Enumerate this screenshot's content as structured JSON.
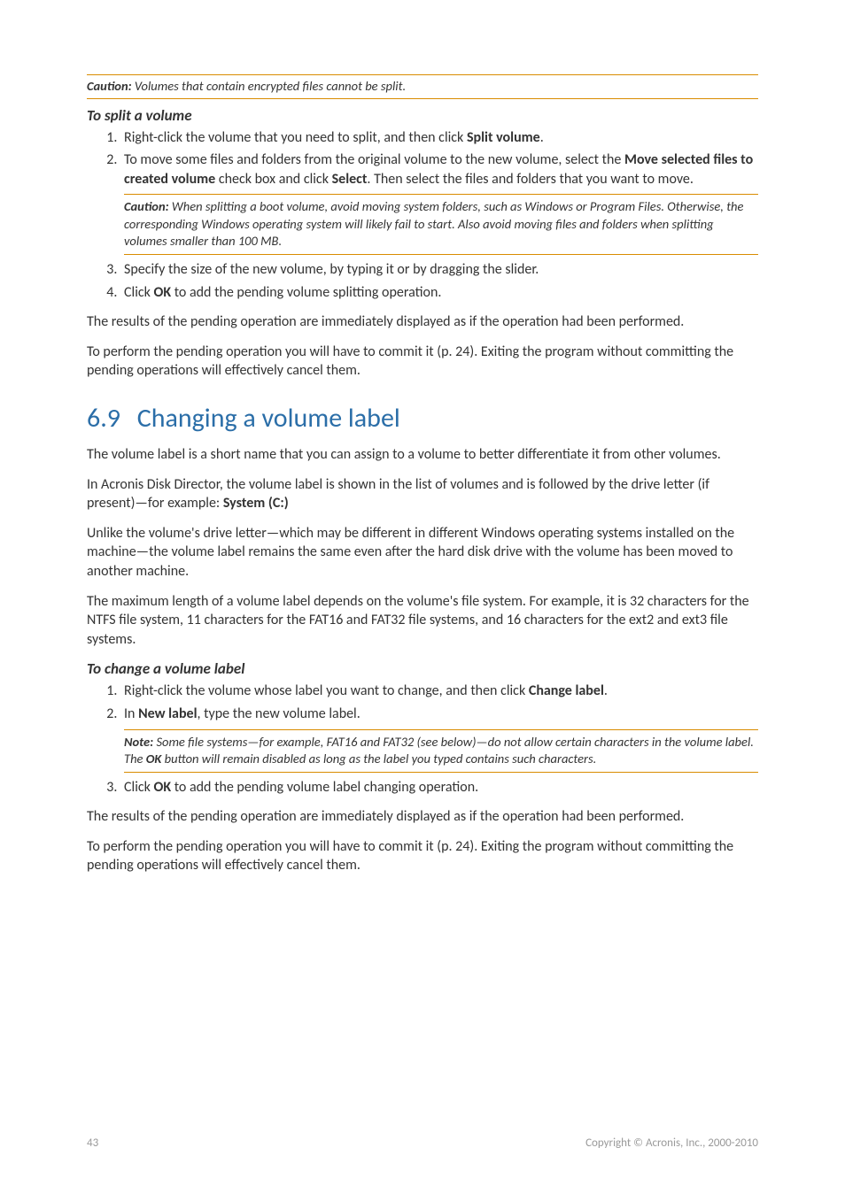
{
  "caution1": {
    "lead": "Caution:",
    "text": " Volumes that contain encrypted files cannot be split."
  },
  "splitHead": "To split a volume",
  "steps1": {
    "s1a": "Right-click the volume that you need to split, and then click ",
    "s1b": "Split volume",
    "s1c": ".",
    "s2a": "To move some files and folders from the original volume to the new volume, select the ",
    "s2b": "Move selected files to created volume",
    "s2c": " check box and click ",
    "s2d": "Select",
    "s2e": ". Then select the files and folders that you want to move.",
    "s3": "Specify the size of the new volume, by typing it or by dragging the slider.",
    "s4a": "Click ",
    "s4b": "OK",
    "s4c": " to add the pending volume splitting operation."
  },
  "caution2": {
    "lead": "Caution:",
    "text": " When splitting a boot volume, avoid moving system folders, such as Windows or Program Files. Otherwise, the corresponding Windows operating system will likely fail to start. Also avoid moving files and folders when splitting volumes smaller than 100 MB."
  },
  "para1": "The results of the pending operation are immediately displayed as if the operation had been performed.",
  "para2": "To perform the pending operation you will have to commit it (p. 24). Exiting the program without committing the pending operations will effectively cancel them.",
  "section": {
    "num": "6.9",
    "title": "Changing a volume label"
  },
  "sec_p1": "The volume label is a short name that you can assign to a volume to better differentiate it from other volumes.",
  "sec_p2a": "In Acronis Disk Director, the volume label is shown in the list of volumes and is followed by the drive letter (if present)—for example: ",
  "sec_p2b": "System (C:)",
  "sec_p3": "Unlike the volume's drive letter—which may be different in different Windows operating systems installed on the machine—the volume label remains the same even after the hard disk drive with the volume has been moved to another machine.",
  "sec_p4": "The maximum length of a volume label depends on the volume's file system. For example, it is 32 characters for the NTFS file system, 11 characters for the FAT16 and FAT32 file systems, and 16 characters for the ext2 and ext3 file systems.",
  "changeHead": "To change a volume label",
  "steps2": {
    "s1a": "Right-click the volume whose label you want to change, and then click ",
    "s1b": "Change label",
    "s1c": ".",
    "s2a": "In ",
    "s2b": "New label",
    "s2c": ", type the new volume label.",
    "s3a": "Click ",
    "s3b": "OK",
    "s3c": " to add the pending volume label changing operation."
  },
  "note1": {
    "lead": "Note:",
    "a": " Some file systems—for example, FAT16 and FAT32 (see below)—do not allow certain characters in the volume label. The ",
    "b": "OK",
    "c": " button will remain disabled as long as the label you typed contains such characters."
  },
  "para3": "The results of the pending operation are immediately displayed as if the operation had been performed.",
  "para4": "To perform the pending operation you will have to commit it (p. 24). Exiting the program without committing the pending operations will effectively cancel them.",
  "footer": {
    "page": "43",
    "copyright": "Copyright © Acronis, Inc., 2000-2010"
  }
}
